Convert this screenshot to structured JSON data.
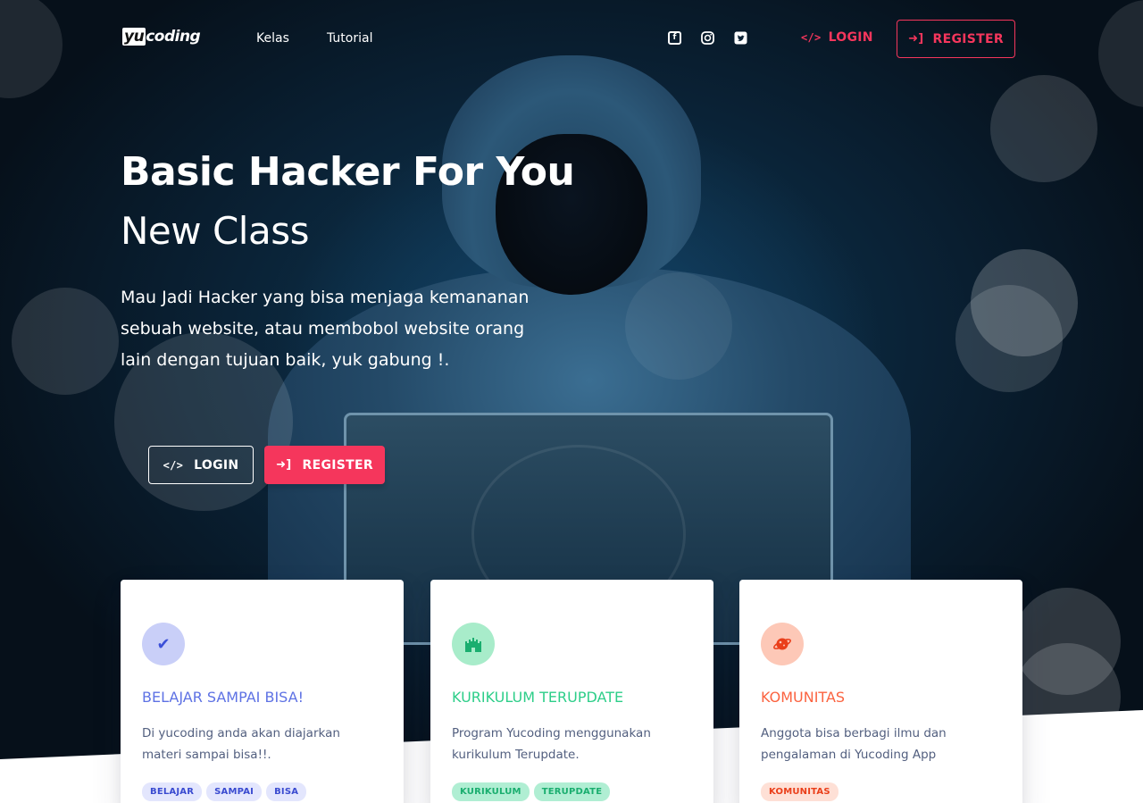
{
  "nav": {
    "logo_prefix": "yu",
    "logo_suffix": "coding",
    "links": [
      "Kelas",
      "Tutorial"
    ],
    "social_icons": [
      "facebook-icon",
      "instagram-icon",
      "twitter-icon"
    ],
    "login_label": "LOGIN",
    "register_label": "REGISTER"
  },
  "hero": {
    "title": "Basic Hacker For You",
    "subtitle": "New Class",
    "description": "Mau Jadi Hacker yang bisa menjaga kemananan sebuah website, atau membobol website orang lain dengan tujuan baik, yuk gabung !.",
    "login_label": "LOGIN",
    "register_label": "REGISTER"
  },
  "cards": [
    {
      "icon": "check-icon",
      "title": "BELAJAR SAMPAI BISA!",
      "text": "Di yucoding anda akan diajarkan materi sampai bisa!!.",
      "badges": [
        "BELAJAR",
        "SAMPAI",
        "BISA"
      ]
    },
    {
      "icon": "castle-icon",
      "title": "KURIKULUM TERUPDATE",
      "text": "Program Yucoding menggunakan kurikulum Terupdate.",
      "badges": [
        "KURIKULUM",
        "TERUPDATE"
      ]
    },
    {
      "icon": "planet-icon",
      "title": "KOMUNITAS",
      "text": "Anggota bisa berbagi ilmu dan pengalaman di Yucoding App",
      "badges": [
        "KOMUNITAS"
      ]
    }
  ],
  "colors": {
    "accent": "#f5365c",
    "primary": "#5e72e4",
    "success": "#2dce89",
    "warning": "#fb6340"
  }
}
